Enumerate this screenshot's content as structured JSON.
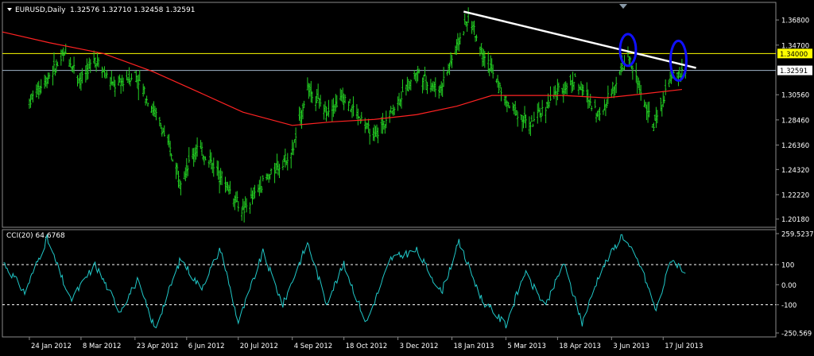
{
  "main_header": {
    "symbol": "EURUSD,Daily",
    "ohlc": "1.32576 1.32710 1.32458 1.32591"
  },
  "cci_header": {
    "label": "CCI(20) 64.6768"
  },
  "chart_data": [
    {
      "type": "bar",
      "subtype": "ohlc",
      "ylim": [
        1.195,
        1.382
      ],
      "y_ticks": [
        "1.36800",
        "1.34700",
        "1.32591",
        "1.30560",
        "1.28460",
        "1.26360",
        "1.24320",
        "1.22220",
        "1.20180"
      ],
      "y_tick_values": [
        1.368,
        1.347,
        1.32591,
        1.3056,
        1.2846,
        1.2636,
        1.2432,
        1.2222,
        1.2018
      ],
      "x_ticks": [
        "24 Jan 2012",
        "8 Mar 2012",
        "23 Apr 2012",
        "6 Jun 2012",
        "20 Jul 2012",
        "4 Sep 2012",
        "18 Oct 2012",
        "3 Dec 2012",
        "18 Jan 2013",
        "5 Mar 2013",
        "18 Apr 2013",
        "3 Jun 2013",
        "17 Jul 2013"
      ],
      "close_path": [
        {
          "d": "2012-01-24",
          "v": 1.3
        },
        {
          "d": "2012-02-10",
          "v": 1.322
        },
        {
          "d": "2012-02-24",
          "v": 1.34
        },
        {
          "d": "2012-03-08",
          "v": 1.318
        },
        {
          "d": "2012-03-20",
          "v": 1.336
        },
        {
          "d": "2012-04-05",
          "v": 1.312
        },
        {
          "d": "2012-04-23",
          "v": 1.323
        },
        {
          "d": "2012-05-15",
          "v": 1.28
        },
        {
          "d": "2012-06-01",
          "v": 1.235
        },
        {
          "d": "2012-06-15",
          "v": 1.262
        },
        {
          "d": "2012-07-01",
          "v": 1.245
        },
        {
          "d": "2012-07-24",
          "v": 1.208
        },
        {
          "d": "2012-08-10",
          "v": 1.232
        },
        {
          "d": "2012-09-04",
          "v": 1.258
        },
        {
          "d": "2012-09-17",
          "v": 1.312
        },
        {
          "d": "2012-10-03",
          "v": 1.292
        },
        {
          "d": "2012-10-18",
          "v": 1.304
        },
        {
          "d": "2012-11-13",
          "v": 1.27
        },
        {
          "d": "2012-12-03",
          "v": 1.3
        },
        {
          "d": "2012-12-19",
          "v": 1.325
        },
        {
          "d": "2013-01-07",
          "v": 1.308
        },
        {
          "d": "2013-02-01",
          "v": 1.37
        },
        {
          "d": "2013-02-15",
          "v": 1.338
        },
        {
          "d": "2013-03-05",
          "v": 1.3
        },
        {
          "d": "2013-03-26",
          "v": 1.28
        },
        {
          "d": "2013-04-18",
          "v": 1.308
        },
        {
          "d": "2013-05-03",
          "v": 1.318
        },
        {
          "d": "2013-05-24",
          "v": 1.288
        },
        {
          "d": "2013-06-17",
          "v": 1.338
        },
        {
          "d": "2013-07-09",
          "v": 1.278
        },
        {
          "d": "2013-07-23",
          "v": 1.318
        },
        {
          "d": "2013-08-05",
          "v": 1.326
        }
      ],
      "moving_average": [
        {
          "d": "2012-01-01",
          "v": 1.358
        },
        {
          "d": "2012-02-10",
          "v": 1.349
        },
        {
          "d": "2012-03-27",
          "v": 1.34
        },
        {
          "d": "2012-05-08",
          "v": 1.325
        },
        {
          "d": "2012-06-18",
          "v": 1.307
        },
        {
          "d": "2012-07-24",
          "v": 1.291
        },
        {
          "d": "2012-09-04",
          "v": 1.28
        },
        {
          "d": "2012-10-08",
          "v": 1.283
        },
        {
          "d": "2012-11-13",
          "v": 1.285
        },
        {
          "d": "2012-12-19",
          "v": 1.289
        },
        {
          "d": "2013-01-22",
          "v": 1.296
        },
        {
          "d": "2013-02-21",
          "v": 1.305
        },
        {
          "d": "2013-03-26",
          "v": 1.305
        },
        {
          "d": "2013-04-23",
          "v": 1.305
        },
        {
          "d": "2013-05-29",
          "v": 1.303
        },
        {
          "d": "2013-06-27",
          "v": 1.306
        },
        {
          "d": "2013-08-02",
          "v": 1.31
        }
      ],
      "trendline": [
        {
          "d": "2013-01-28",
          "v": 1.375
        },
        {
          "d": "2013-08-14",
          "v": 1.328
        }
      ],
      "horizontal_lines": [
        {
          "label": "1.34000",
          "v": 1.34,
          "color": "#ffff00"
        },
        {
          "label": "1.32591",
          "v": 1.32591,
          "color": "#a0b4c8"
        }
      ],
      "ellipses": [
        {
          "d": "2013-06-17",
          "v": 1.343
        },
        {
          "d": "2013-07-30",
          "v": 1.334
        }
      ],
      "colors": {
        "bars": "#22cc22",
        "ma": "#ff2222",
        "trendline": "#ffffff",
        "ellipse": "#1010ff",
        "grid_text": "#ffffff"
      }
    },
    {
      "type": "line",
      "name": "CCI(20)",
      "ylim": [
        -260,
        270
      ],
      "y_ticks": [
        "259.5237",
        "100",
        "0.00",
        "-100",
        "-250.569"
      ],
      "y_tick_values": [
        259.5237,
        100,
        0,
        -100,
        -250.569
      ],
      "levels": [
        100,
        -100
      ],
      "values_path": [
        {
          "d": "2012-01-01",
          "v": 120
        },
        {
          "d": "2012-01-20",
          "v": -40
        },
        {
          "d": "2012-02-08",
          "v": 230
        },
        {
          "d": "2012-02-28",
          "v": -80
        },
        {
          "d": "2012-03-20",
          "v": 100
        },
        {
          "d": "2012-04-10",
          "v": -130
        },
        {
          "d": "2012-04-25",
          "v": 20
        },
        {
          "d": "2012-05-10",
          "v": -220
        },
        {
          "d": "2012-06-01",
          "v": 130
        },
        {
          "d": "2012-06-18",
          "v": -20
        },
        {
          "d": "2012-07-05",
          "v": 180
        },
        {
          "d": "2012-07-20",
          "v": -190
        },
        {
          "d": "2012-08-10",
          "v": 160
        },
        {
          "d": "2012-08-27",
          "v": -100
        },
        {
          "d": "2012-09-17",
          "v": 210
        },
        {
          "d": "2012-10-03",
          "v": -90
        },
        {
          "d": "2012-10-18",
          "v": 100
        },
        {
          "d": "2012-11-06",
          "v": -190
        },
        {
          "d": "2012-11-27",
          "v": 130
        },
        {
          "d": "2012-12-19",
          "v": 170
        },
        {
          "d": "2013-01-09",
          "v": -40
        },
        {
          "d": "2013-01-24",
          "v": 210
        },
        {
          "d": "2013-02-13",
          "v": -80
        },
        {
          "d": "2013-03-05",
          "v": -200
        },
        {
          "d": "2013-03-21",
          "v": 60
        },
        {
          "d": "2013-04-08",
          "v": -110
        },
        {
          "d": "2013-04-23",
          "v": 110
        },
        {
          "d": "2013-05-09",
          "v": -190
        },
        {
          "d": "2013-05-24",
          "v": 60
        },
        {
          "d": "2013-06-12",
          "v": 250
        },
        {
          "d": "2013-06-28",
          "v": 90
        },
        {
          "d": "2013-07-11",
          "v": -130
        },
        {
          "d": "2013-07-24",
          "v": 130
        },
        {
          "d": "2013-08-05",
          "v": 65
        }
      ],
      "colors": {
        "line": "#20c8c8",
        "level": "#ffffff"
      }
    }
  ]
}
